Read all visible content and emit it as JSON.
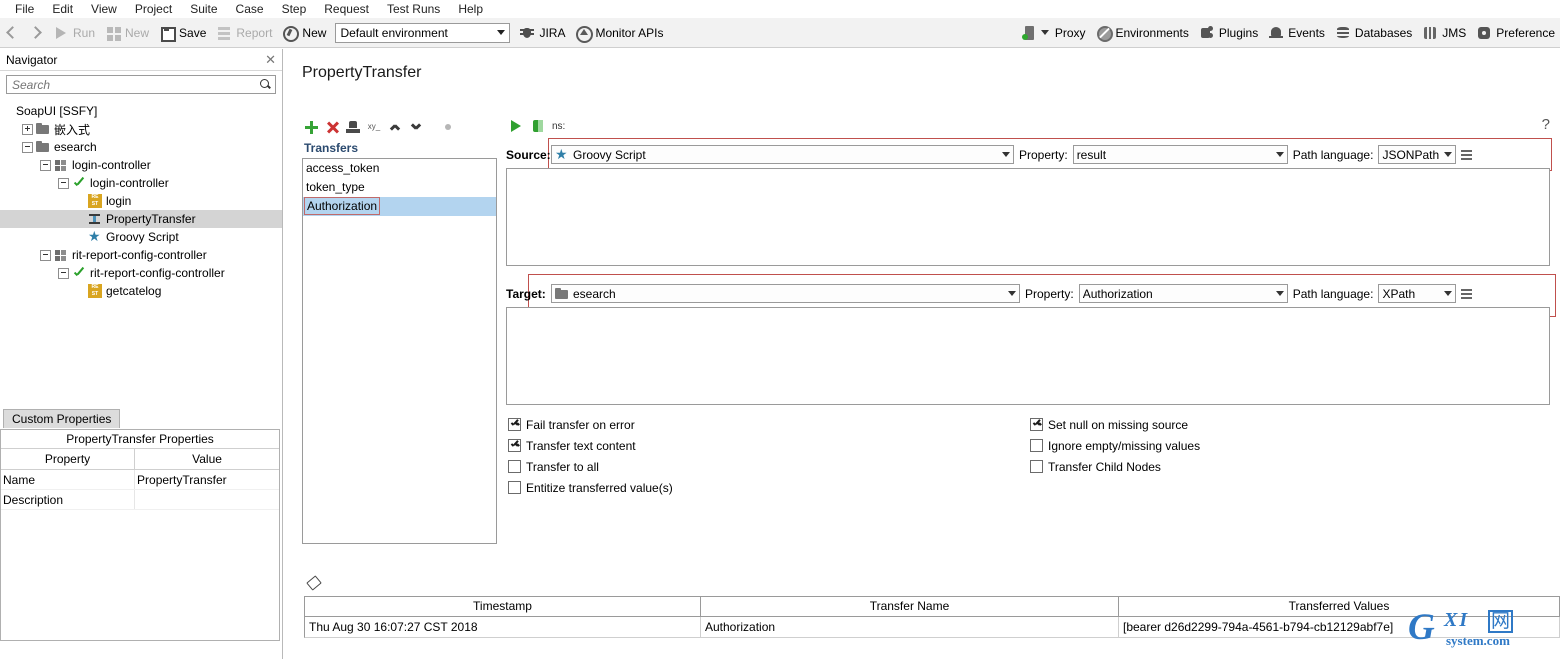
{
  "menubar": {
    "items": [
      "File",
      "Edit",
      "View",
      "Project",
      "Suite",
      "Case",
      "Step",
      "Request",
      "Test Runs",
      "Help"
    ]
  },
  "toolbar": {
    "back_icon": "back-arrow-icon",
    "forward_icon": "forward-arrow-icon",
    "run_label": "Run",
    "new_label": "New",
    "save_label": "Save",
    "report_label": "Report",
    "new2_label": "New",
    "environment_value": "Default environment",
    "jira_label": "JIRA",
    "monitor_label": "Monitor APIs",
    "proxy_label": "Proxy",
    "environments_label": "Environments",
    "plugins_label": "Plugins",
    "events_label": "Events",
    "databases_label": "Databases",
    "jms_label": "JMS",
    "preferences_label": "Preference"
  },
  "navigator": {
    "title": "Navigator",
    "close_icon": "close-icon",
    "search_placeholder": "Search",
    "search_value": "",
    "tree": [
      {
        "label": "SoapUI [SSFY]",
        "depth": 0,
        "toggle": "none",
        "icon": "none",
        "selected": false
      },
      {
        "label": "嵌入式",
        "depth": 1,
        "toggle": "plus",
        "icon": "folder",
        "selected": false
      },
      {
        "label": "esearch",
        "depth": 1,
        "toggle": "minus",
        "icon": "folder",
        "selected": false
      },
      {
        "label": "login-controller",
        "depth": 2,
        "toggle": "minus",
        "icon": "grid",
        "selected": false
      },
      {
        "label": "login-controller",
        "depth": 3,
        "toggle": "minus",
        "icon": "check",
        "selected": false
      },
      {
        "label": "login",
        "depth": 4,
        "toggle": "none",
        "icon": "rest",
        "selected": false
      },
      {
        "label": "PropertyTransfer",
        "depth": 4,
        "toggle": "none",
        "icon": "transfer",
        "selected": true
      },
      {
        "label": "Groovy Script",
        "depth": 4,
        "toggle": "none",
        "icon": "star",
        "selected": false
      },
      {
        "label": "rit-report-config-controller",
        "depth": 2,
        "toggle": "minus",
        "icon": "grid",
        "selected": false
      },
      {
        "label": "rit-report-config-controller",
        "depth": 3,
        "toggle": "minus",
        "icon": "check",
        "selected": false
      },
      {
        "label": "getcatelog",
        "depth": 4,
        "toggle": "none",
        "icon": "rest",
        "selected": false
      }
    ]
  },
  "custom_properties": {
    "tab_label": "Custom Properties",
    "panel_title": "PropertyTransfer Properties",
    "columns": [
      "Property",
      "Value"
    ],
    "rows": [
      {
        "property": "Name",
        "value": "PropertyTransfer"
      },
      {
        "property": "Description",
        "value": ""
      }
    ]
  },
  "main": {
    "page_title": "PropertyTransfer",
    "help_icon": "?",
    "transfers": {
      "toolbar_icons": [
        "add-icon",
        "delete-icon",
        "stamp-icon",
        "xy-icon",
        "move-up-icon",
        "move-down-icon",
        "status-dot-icon"
      ],
      "xy_label": "xy_",
      "caption": "Transfers",
      "items": [
        {
          "label": "access_token",
          "selected": false,
          "boxed": false
        },
        {
          "label": "token_type",
          "selected": false,
          "boxed": false
        },
        {
          "label": "Authorization",
          "selected": true,
          "boxed": true
        }
      ]
    },
    "editor": {
      "run_icon": "run-icon",
      "run_step_icon": "run-step-icon",
      "ns_label": "ns:",
      "source": {
        "label": "Source:",
        "value": "Groovy Script",
        "icon": "star-icon",
        "property_label": "Property:",
        "property_value": "result",
        "path_language_label": "Path language:",
        "path_language_value": "JSONPath",
        "list_icon": "list-icon",
        "expression": ""
      },
      "target": {
        "label": "Target:",
        "value": "esearch",
        "icon": "folder-icon",
        "property_label": "Property:",
        "property_value": "Authorization",
        "path_language_label": "Path language:",
        "path_language_value": "XPath",
        "list_icon": "list-icon",
        "expression": ""
      },
      "options_left": [
        {
          "label": "Fail transfer on error",
          "checked": true
        },
        {
          "label": "Transfer text content",
          "checked": true
        },
        {
          "label": "Transfer to all",
          "checked": false
        },
        {
          "label": "Entitize transferred value(s)",
          "checked": false
        }
      ],
      "options_right": [
        {
          "label": "Set null on missing source",
          "checked": true
        },
        {
          "label": "Ignore empty/missing values",
          "checked": false
        },
        {
          "label": "Transfer Child Nodes",
          "checked": false
        }
      ]
    },
    "results": {
      "clear_icon": "eraser-icon",
      "columns": [
        "Timestamp",
        "Transfer Name",
        "Transferred Values"
      ],
      "rows": [
        {
          "timestamp": "Thu Aug 30 16:07:27 CST 2018",
          "transfer_name": "Authorization",
          "transferred_values": "[bearer d26d2299-794a-4561-b794-cb12129abf7e]"
        }
      ]
    }
  },
  "watermark": {
    "g": "G",
    "xi": "XI",
    "cn": "网",
    "sys": "system.com"
  },
  "colors": {
    "accent_green": "#36a336",
    "accent_red": "#cc3333",
    "selection_blue": "#b3d4ef",
    "highlight_box": "#c0504d",
    "caption_blue": "#2b4a6f"
  }
}
